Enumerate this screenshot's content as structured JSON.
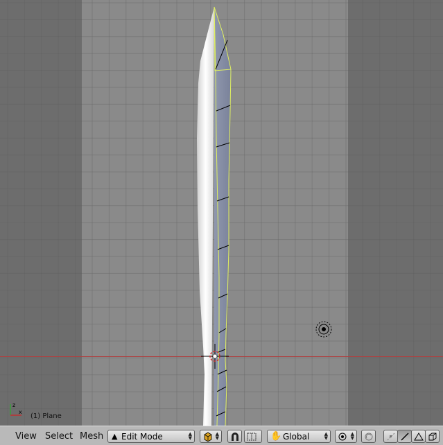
{
  "viewport": {
    "object_label": "(1) Plane",
    "axis_labels": {
      "x": "x",
      "z": "z"
    }
  },
  "header": {
    "menus": [
      "View",
      "Select",
      "Mesh"
    ],
    "mode_select": {
      "value": "Edit Mode"
    },
    "orientation_select": {
      "value": "Global"
    }
  },
  "colors": {
    "viewport_bg": "#6d6d6d",
    "camera_frame": "#8a8a8a",
    "grid_line": "#5e5e5e",
    "x_axis_line": "#b04040",
    "mesh_edge_selected": "#e0f060",
    "mesh_edge": "#000000",
    "header_bg": "#b9b9b9"
  },
  "icons": {
    "axis_gizmo": "axis-gizmo-icon",
    "cursor_3d": "3d-cursor-icon",
    "lamp": "lamp-icon"
  }
}
